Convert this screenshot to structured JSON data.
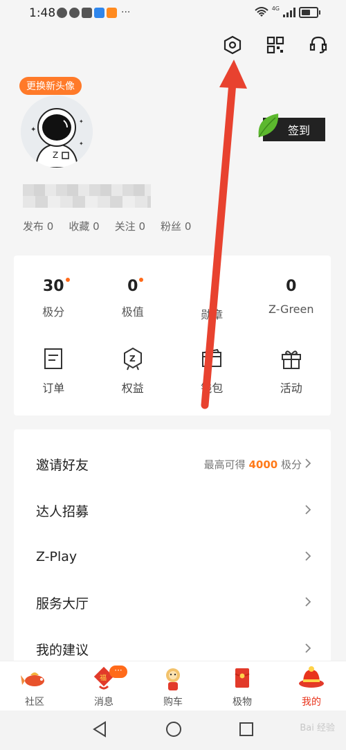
{
  "status_bar": {
    "time": "1:48",
    "more": "···",
    "network_label": "4G",
    "notification_icons": [
      "chat-bubble-icon",
      "chat-bubble-icon",
      "app-icon",
      "blue-app-icon",
      "orange-play-icon"
    ]
  },
  "top_icons": [
    "settings-hexagon-icon",
    "qr-scan-icon",
    "customer-service-icon"
  ],
  "profile": {
    "avatar_badge": "更换新头像",
    "checkin_label": "签到",
    "stats": [
      {
        "label": "发布",
        "value": "0"
      },
      {
        "label": "收藏",
        "value": "0"
      },
      {
        "label": "关注",
        "value": "0"
      },
      {
        "label": "粉丝",
        "value": "0"
      }
    ]
  },
  "assets": [
    {
      "value": "30",
      "label": "极分",
      "dot": true
    },
    {
      "value": "0",
      "label": "极值",
      "dot": true
    },
    {
      "value": "",
      "label": "勋章",
      "dot": false
    },
    {
      "value": "0",
      "label": "Z-Green",
      "dot": false
    }
  ],
  "functions": [
    {
      "label": "订单",
      "icon": "order-icon"
    },
    {
      "label": "权益",
      "icon": "rights-badge-icon"
    },
    {
      "label": "钱包",
      "icon": "wallet-icon"
    },
    {
      "label": "活动",
      "icon": "gift-icon"
    }
  ],
  "menu": [
    {
      "label": "邀请好友",
      "right_prefix": "最高可得",
      "right_highlight": "4000",
      "right_suffix": "极分"
    },
    {
      "label": "达人招募"
    },
    {
      "label": "Z-Play"
    },
    {
      "label": "服务大厅"
    },
    {
      "label": "我的建议"
    }
  ],
  "bottom_nav": [
    {
      "label": "社区",
      "icon": "koi-fish-icon"
    },
    {
      "label": "消息",
      "icon": "lucky-fish-icon",
      "badge": "···"
    },
    {
      "label": "购车",
      "icon": "lion-mascot-icon"
    },
    {
      "label": "极物",
      "icon": "red-envelope-icon"
    },
    {
      "label": "我的",
      "icon": "festive-hat-icon",
      "active": true
    }
  ],
  "colors": {
    "accent": "#ff7a29",
    "active_tab": "#e8341c",
    "annotation_arrow": "#e8422f"
  },
  "watermark": "Bai 经验"
}
